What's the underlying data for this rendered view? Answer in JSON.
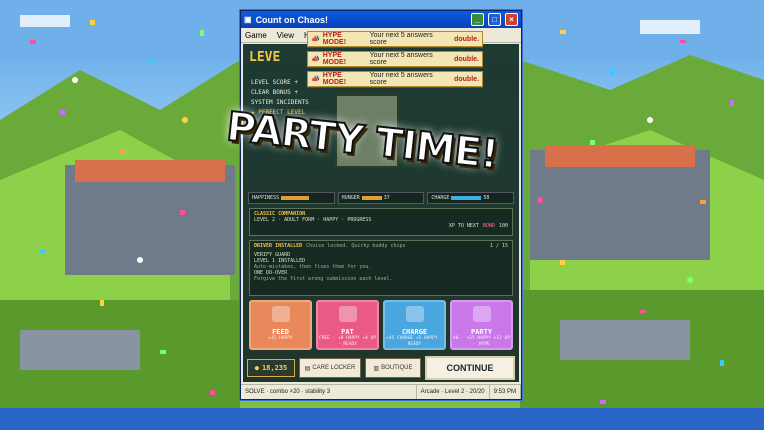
{
  "window": {
    "title": "Count on Chaos!",
    "menu": [
      "Game",
      "View",
      "H"
    ]
  },
  "toasts": [
    {
      "title": "HYPE MODE!",
      "text": "Your next 5 answers score",
      "emph": "double."
    },
    {
      "title": "HYPE MODE!",
      "text": "Your next 5 answers score",
      "emph": "double."
    },
    {
      "title": "HYPE MODE!",
      "text": "Your next 5 answers score",
      "emph": "double."
    }
  ],
  "game": {
    "level_header": "LEVE",
    "stats": [
      "LEVEL SCORE +",
      "CLEAR BONUS +",
      "SYSTEM INCIDENTS",
      "★ PERFECT LEVEL"
    ],
    "party_text": "PARTY TIME!",
    "meters": [
      {
        "label": "HAPPINESS",
        "value": "",
        "level": 0.55
      },
      {
        "label": "HUNGER",
        "value": "37",
        "level": 0.37
      },
      {
        "label": "CHARGE",
        "value": "58",
        "level": 0.58
      }
    ],
    "companion": {
      "header": "CLASSIC COMPANION",
      "line1": "LEVEL 2 · ADULT FORM · HAPPY · PROGRESS",
      "line2": "XP TO NEXT",
      "bond_label": "BOND",
      "bond_value": "100"
    },
    "driver": {
      "header": "DRIVER INSTALLED",
      "note": "Choice locked. Quirky buddy chips",
      "progress": "1 / 15",
      "items": [
        "VERIFY GUARD",
        "LEVEL 1 INSTALLED",
        "Auto-mistakes, then fixes them for you.",
        "ONE DO-OVER",
        "Forgive the first wrong submission each level."
      ]
    },
    "actions": [
      {
        "label": "FEED",
        "sub": "+15 HAPPY",
        "color": "#e9885a"
      },
      {
        "label": "PAT",
        "sub": "FREE · +8 HAPPY +4 XP · READY",
        "color": "#e95a85"
      },
      {
        "label": "CHARGE",
        "sub": "+45 CHARGE +5 HAPPY · READY",
        "color": "#49a6de"
      },
      {
        "label": "PARTY",
        "sub": "40 · +25 HAPPY +12 XP · HYPE",
        "color": "#c878e8"
      }
    ],
    "coins": "18,235",
    "care_button": "CARE LOCKER",
    "boutique_button": "BOUTIQUE",
    "continue_button": "CONTINUE"
  },
  "status": {
    "left": "SOLVE · combo ×20 · stability 3",
    "mid": "Arcade · Level 2 · 20/20",
    "time": "9:53 PM"
  },
  "colors": {
    "accent": "#f5c542",
    "titlebar": "#0a5ee0",
    "grass": "#7cc043"
  }
}
